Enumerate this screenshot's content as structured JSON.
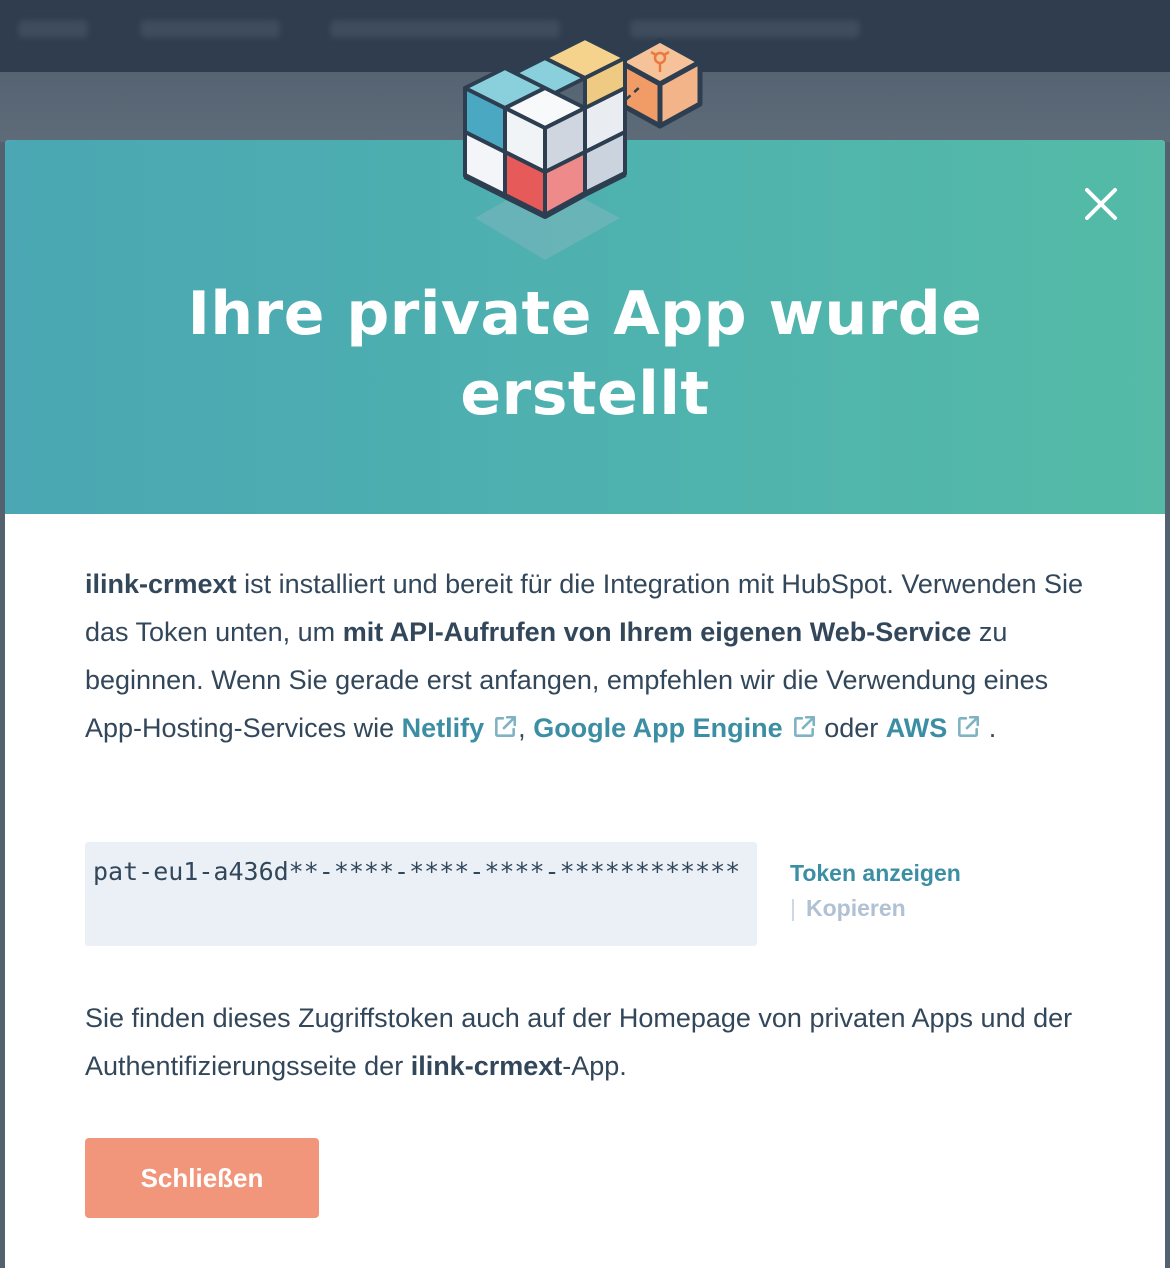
{
  "modal": {
    "title_line1": "Ihre private App wurde",
    "title_line2": "erstellt",
    "intro": {
      "app_name": "ilink-crmext",
      "text1": " ist installiert und bereit für die Integration mit HubSpot. Verwenden Sie das Token unten, um ",
      "bold_phrase": "mit API-Aufrufen von Ihrem eigenen Web-Service",
      "text2": " zu beginnen. Wenn Sie gerade erst anfangen, empfehlen wir die Verwendung eines App-Hosting-Services wie ",
      "link_netlify": "Netlify",
      "comma": ",",
      "link_google": "Google App Engine",
      "text_or": " oder ",
      "link_aws": "AWS",
      "period": "."
    },
    "token": {
      "value": "pat-eu1-a436d**-****-****-****-************",
      "show_label": "Token anzeigen",
      "copy_label": "Kopieren",
      "separator": "|"
    },
    "note": {
      "text1": "Sie finden dieses Zugriffstoken auch auf der Homepage von privaten Apps und der Authentifizierungsseite der ",
      "app_name": "ilink-crmext",
      "text2": "-App."
    },
    "close_button_label": "Schließen"
  },
  "colors": {
    "header_gradient_start": "#4aa7b3",
    "header_gradient_end": "#55bba7",
    "link": "#3b8ea3",
    "primary_button": "#f2967b",
    "text": "#33475b",
    "token_bg": "#eaf0f6"
  },
  "icons": {
    "close": "close-icon",
    "external_link": "external-link-icon",
    "illustration": "stacked-cubes-illustration"
  }
}
